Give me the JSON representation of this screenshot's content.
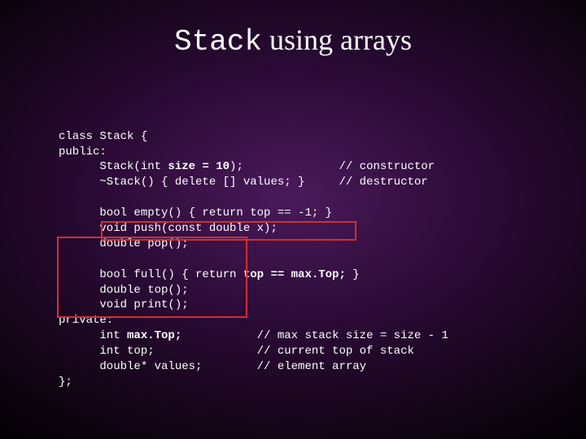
{
  "title": {
    "mono": "Stack",
    "rest": " using arrays"
  },
  "code": {
    "l01": "class Stack {",
    "l02": "public:",
    "l03a": "      Stack(int ",
    "l03b": "size = 10",
    "l03c": ");              // constructor",
    "l04": "      ~Stack() { delete [] values; }     // destructor",
    "l05": "",
    "l06": "      bool empty() { return top == -1; }",
    "l07": "      void push(const double x);",
    "l08": "      double pop();",
    "l09": "",
    "l10a": "      bool full() { return ",
    "l10b": "top == max.Top;",
    "l10c": " }",
    "l11": "      double top();",
    "l12": "      void print();",
    "l13": "private:",
    "l14a": "      int ",
    "l14b": "max.Top;",
    "l14c": "           // max stack size = size - 1",
    "l15": "      int top;               // current top of stack",
    "l16": "      double* values;        // element array",
    "l17": "};"
  }
}
